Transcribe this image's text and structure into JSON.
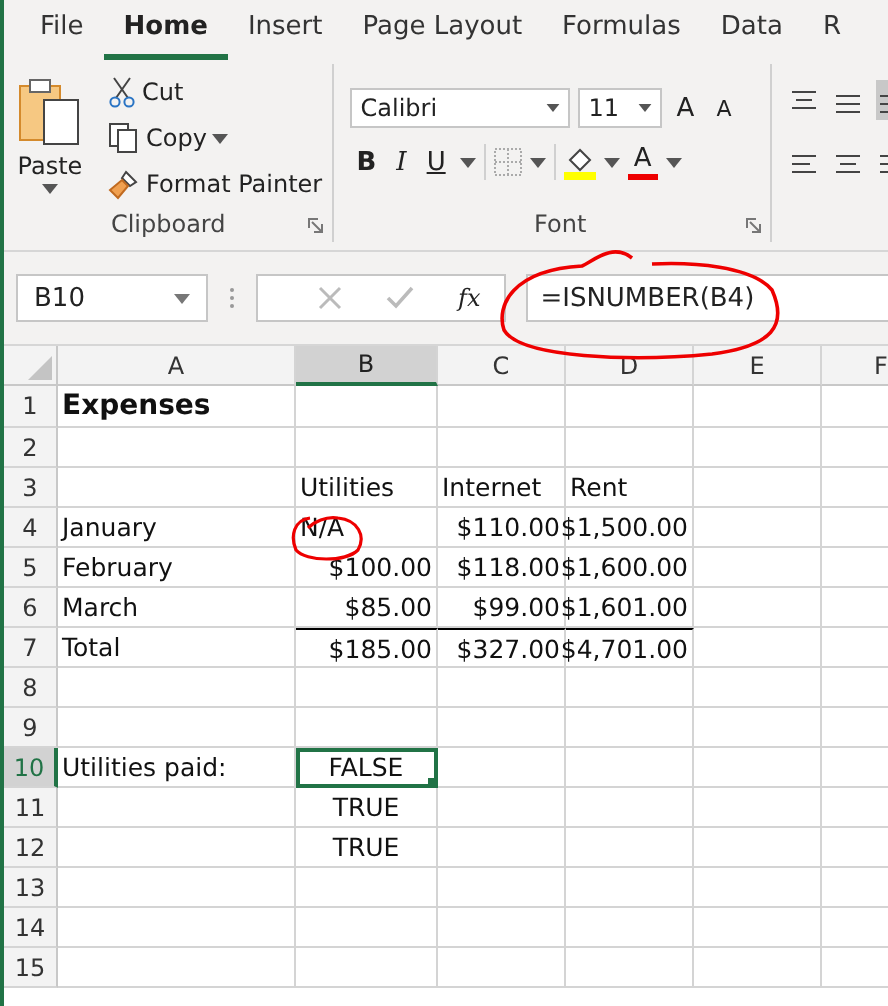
{
  "tabs": [
    {
      "label": "File",
      "selected": false
    },
    {
      "label": "Home",
      "selected": true
    },
    {
      "label": "Insert",
      "selected": false
    },
    {
      "label": "Page Layout",
      "selected": false
    },
    {
      "label": "Formulas",
      "selected": false
    },
    {
      "label": "Data",
      "selected": false
    },
    {
      "label": "R",
      "selected": false
    }
  ],
  "ribbon": {
    "clipboard": {
      "paste": "Paste",
      "cut": "Cut",
      "copy": "Copy",
      "format_painter": "Format Painter",
      "label": "Clipboard"
    },
    "font": {
      "font_name": "Calibri",
      "font_size": "11",
      "grow": "A",
      "shrink": "A",
      "bold": "B",
      "italic": "I",
      "underline": "U",
      "font_color": "A",
      "label": "Font"
    }
  },
  "formula_bar": {
    "name_box": "B10",
    "function_label": "fx",
    "formula": "=ISNUMBER(B4)"
  },
  "columns": [
    {
      "label": "A",
      "selected": false
    },
    {
      "label": "B",
      "selected": true
    },
    {
      "label": "C",
      "selected": false
    },
    {
      "label": "D",
      "selected": false
    },
    {
      "label": "E",
      "selected": false
    },
    {
      "label": "F",
      "selected": false
    }
  ],
  "rows": [
    {
      "number": "1",
      "selected": false,
      "cells": [
        {
          "text": "Expenses",
          "kind": "text",
          "bold": true,
          "active": false,
          "border_top": false
        },
        null,
        null,
        null,
        null,
        null
      ]
    },
    {
      "number": "2",
      "selected": false,
      "cells": [
        null,
        null,
        null,
        null,
        null,
        null
      ]
    },
    {
      "number": "3",
      "selected": false,
      "cells": [
        null,
        {
          "text": "Utilities",
          "kind": "text",
          "bold": false,
          "active": false,
          "border_top": false
        },
        {
          "text": "Internet",
          "kind": "text",
          "bold": false,
          "active": false,
          "border_top": false
        },
        {
          "text": "Rent",
          "kind": "text",
          "bold": false,
          "active": false,
          "border_top": false
        },
        null,
        null
      ]
    },
    {
      "number": "4",
      "selected": false,
      "cells": [
        {
          "text": "January",
          "kind": "text",
          "bold": false,
          "active": false,
          "border_top": false
        },
        {
          "text": "N/A",
          "kind": "text",
          "bold": false,
          "active": false,
          "border_top": false
        },
        {
          "text": "$110.00",
          "kind": "number",
          "bold": false,
          "active": false,
          "border_top": false
        },
        {
          "text": "$1,500.00",
          "kind": "number",
          "bold": false,
          "active": false,
          "border_top": false
        },
        null,
        null
      ]
    },
    {
      "number": "5",
      "selected": false,
      "cells": [
        {
          "text": "February",
          "kind": "text",
          "bold": false,
          "active": false,
          "border_top": false
        },
        {
          "text": "$100.00",
          "kind": "number",
          "bold": false,
          "active": false,
          "border_top": false
        },
        {
          "text": "$118.00",
          "kind": "number",
          "bold": false,
          "active": false,
          "border_top": false
        },
        {
          "text": "$1,600.00",
          "kind": "number",
          "bold": false,
          "active": false,
          "border_top": false
        },
        null,
        null
      ]
    },
    {
      "number": "6",
      "selected": false,
      "cells": [
        {
          "text": "March",
          "kind": "text",
          "bold": false,
          "active": false,
          "border_top": false
        },
        {
          "text": "$85.00",
          "kind": "number",
          "bold": false,
          "active": false,
          "border_top": false
        },
        {
          "text": "$99.00",
          "kind": "number",
          "bold": false,
          "active": false,
          "border_top": false
        },
        {
          "text": "$1,601.00",
          "kind": "number",
          "bold": false,
          "active": false,
          "border_top": false
        },
        null,
        null
      ]
    },
    {
      "number": "7",
      "selected": false,
      "cells": [
        {
          "text": "Total",
          "kind": "text",
          "bold": false,
          "active": false,
          "border_top": false
        },
        {
          "text": "$185.00",
          "kind": "number",
          "bold": false,
          "active": false,
          "border_top": true
        },
        {
          "text": "$327.00",
          "kind": "number",
          "bold": false,
          "active": false,
          "border_top": true
        },
        {
          "text": "$4,701.00",
          "kind": "number",
          "bold": false,
          "active": false,
          "border_top": true
        },
        null,
        null
      ]
    },
    {
      "number": "8",
      "selected": false,
      "cells": [
        null,
        null,
        null,
        null,
        null,
        null
      ]
    },
    {
      "number": "9",
      "selected": false,
      "cells": [
        null,
        null,
        null,
        null,
        null,
        null
      ]
    },
    {
      "number": "10",
      "selected": true,
      "cells": [
        {
          "text": "Utilities paid:",
          "kind": "text",
          "bold": false,
          "active": false,
          "border_top": false
        },
        {
          "text": "FALSE",
          "kind": "boolean",
          "bold": false,
          "active": true,
          "border_top": false
        },
        null,
        null,
        null,
        null
      ]
    },
    {
      "number": "11",
      "selected": false,
      "cells": [
        null,
        {
          "text": "TRUE",
          "kind": "boolean",
          "bold": false,
          "active": false,
          "border_top": false
        },
        null,
        null,
        null,
        null
      ]
    },
    {
      "number": "12",
      "selected": false,
      "cells": [
        null,
        {
          "text": "TRUE",
          "kind": "boolean",
          "bold": false,
          "active": false,
          "border_top": false
        },
        null,
        null,
        null,
        null
      ]
    },
    {
      "number": "13",
      "selected": false,
      "cells": [
        null,
        null,
        null,
        null,
        null,
        null
      ]
    },
    {
      "number": "14",
      "selected": false,
      "cells": [
        null,
        null,
        null,
        null,
        null,
        null
      ]
    },
    {
      "number": "15",
      "selected": false,
      "cells": [
        null,
        null,
        null,
        null,
        null,
        null
      ]
    }
  ]
}
